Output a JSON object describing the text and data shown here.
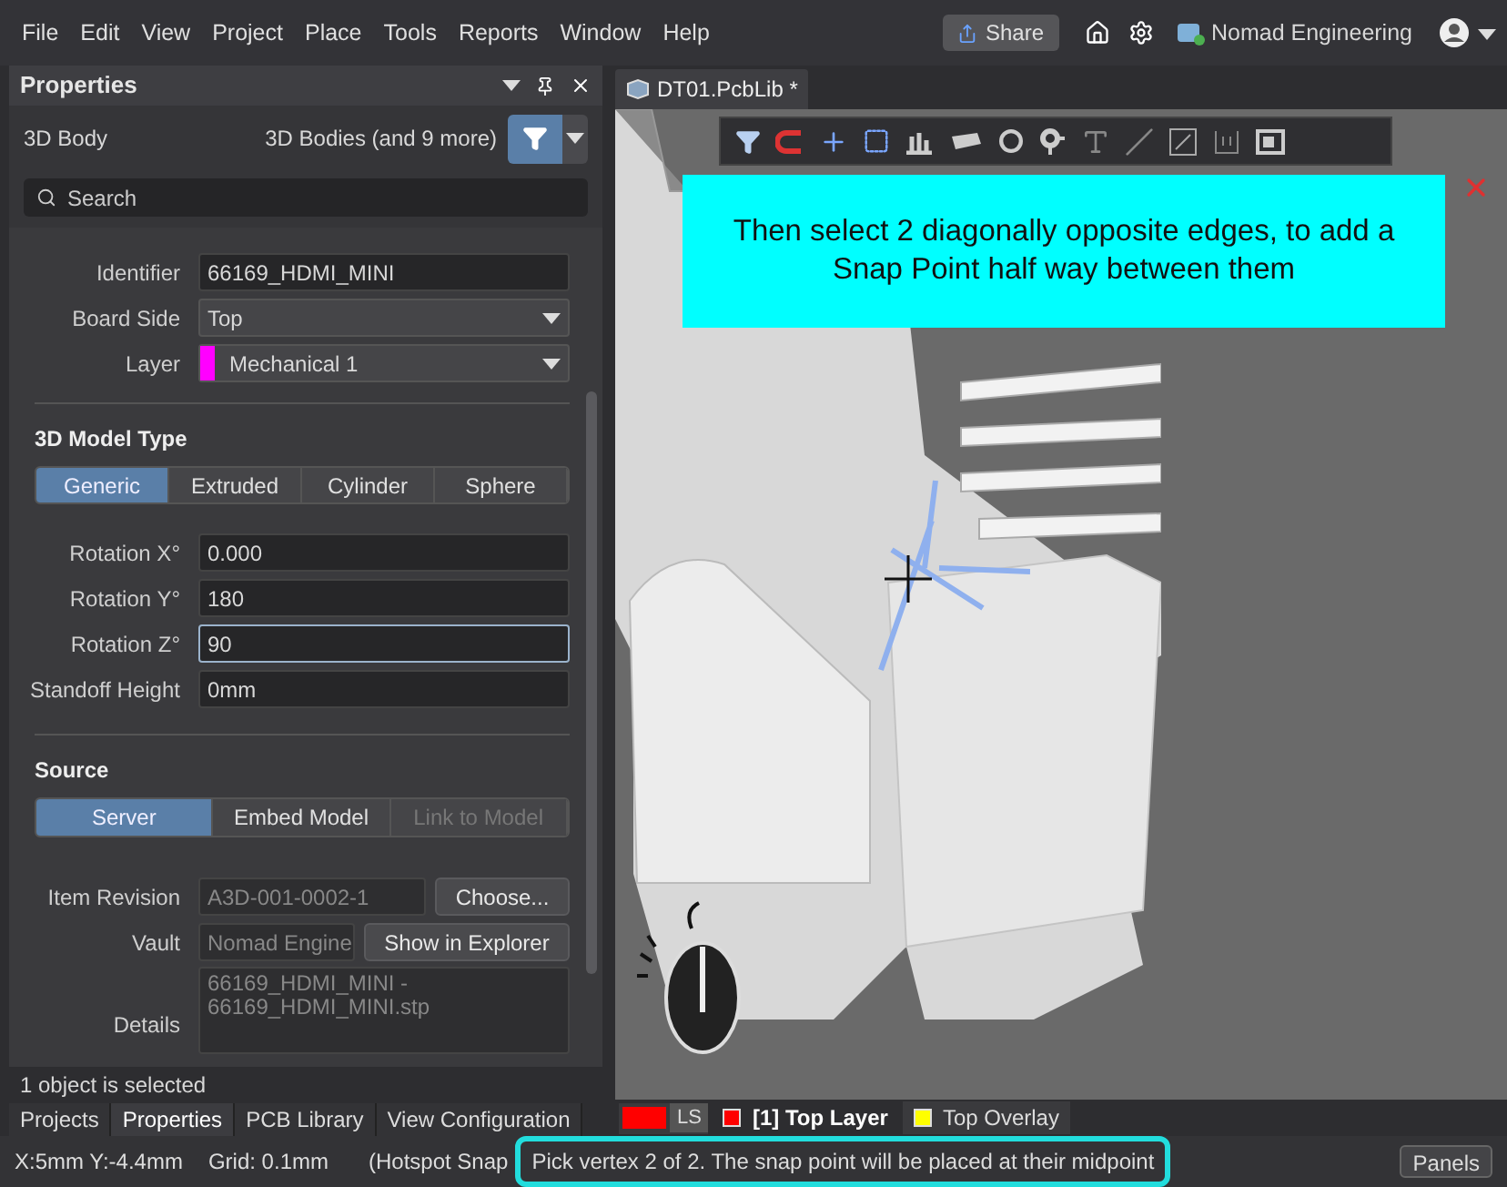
{
  "menu": [
    "File",
    "Edit",
    "View",
    "Project",
    "Place",
    "Tools",
    "Reports",
    "Window",
    "Help"
  ],
  "share_button": "Share",
  "workspace": "Nomad Engineering",
  "panel": {
    "title": "Properties",
    "object_type": "3D Body",
    "filter": "3D Bodies (and 9 more)",
    "search": {
      "placeholder": "Search"
    },
    "fields": [
      {
        "label": "Identifier",
        "value": "66169_HDMI_MINI",
        "kind": "text"
      },
      {
        "label": "Board Side",
        "value": "Top",
        "kind": "select"
      },
      {
        "label": "Layer",
        "value": "Mechanical 1",
        "kind": "layer",
        "color": "#ff00ff"
      }
    ],
    "model_type": {
      "title": "3D Model Type",
      "options": [
        {
          "label": "Generic",
          "selected": true
        },
        {
          "label": "Extruded",
          "selected": false
        },
        {
          "label": "Cylinder",
          "selected": false
        },
        {
          "label": "Sphere",
          "selected": false
        }
      ]
    },
    "rotations": [
      {
        "label": "Rotation X°",
        "value": "0.000",
        "focused": false
      },
      {
        "label": "Rotation Y°",
        "value": "180",
        "focused": false
      },
      {
        "label": "Rotation Z°",
        "value": "90",
        "focused": true
      },
      {
        "label": "Standoff Height",
        "value": "0mm",
        "focused": false
      }
    ],
    "source": {
      "title": "Source",
      "options": [
        {
          "label": "Server",
          "selected": true,
          "disabled": false
        },
        {
          "label": "Embed Model",
          "selected": false,
          "disabled": false
        },
        {
          "label": "Link to Model",
          "selected": false,
          "disabled": true
        }
      ],
      "item_revision": {
        "label": "Item Revision",
        "value": "A3D-001-0002-1",
        "button": "Choose..."
      },
      "vault": {
        "label": "Vault",
        "value": "Nomad Engine",
        "button": "Show in Explorer"
      },
      "details": {
        "label": "Details",
        "value": "66169_HDMI_MINI -\n66169_HDMI_MINI.stp"
      }
    },
    "selection_status": "1 object is selected",
    "tabs": [
      {
        "label": "Projects",
        "selected": false
      },
      {
        "label": "Properties",
        "selected": true
      },
      {
        "label": "PCB Library",
        "selected": false
      },
      {
        "label": "View Configuration",
        "selected": false
      }
    ]
  },
  "document_tab": "DT01.PcbLib *",
  "callout": "Then select 2 diagonally opposite edges, to add a Snap Point half way between them",
  "layers": [
    {
      "label": "LS",
      "kind": "ls",
      "color": "#ff0000",
      "selected": false
    },
    {
      "label": "[1] Top Layer",
      "kind": "layer",
      "color": "#ff0000",
      "selected": true
    },
    {
      "label": "Top Overlay",
      "kind": "layer",
      "color": "#ffff00",
      "selected": false
    }
  ],
  "status_bar": {
    "coordinates": "X:5mm Y:-4.4mm",
    "grid": "Grid: 0.1mm",
    "snap": "(Hotspot Snap",
    "message": "Pick vertex 2 of 2. The snap point will be placed at their midpoint",
    "panels_button": "Panels"
  }
}
